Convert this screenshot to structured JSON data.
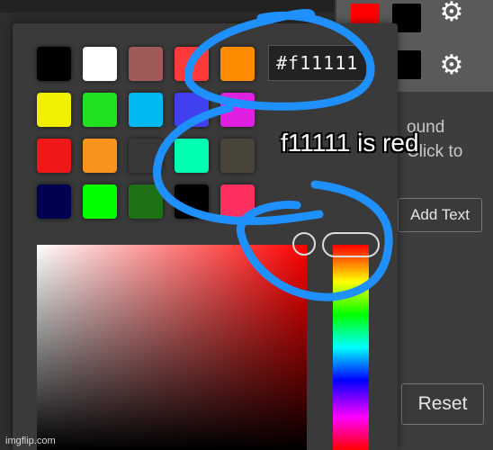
{
  "colors": {
    "swatches": [
      "#000000",
      "#ffffff",
      "#a05a5a",
      "#ff3a3a",
      "#ff8c00",
      "#f0f000",
      "#22e022",
      "#00b8f0",
      "#4040f0",
      "#e020e0",
      "#f01818",
      "#f7941d",
      "#383838",
      "#00ffb0",
      "#4a453a",
      "#000050",
      "#00ff00",
      "#207018",
      "#000000",
      "#ff3060"
    ],
    "side_swatch_top_red": "#ff0000",
    "side_swatch_top_black": "#000000",
    "side_swatch_mid_black": "#000000",
    "scribble": "#1e90ff"
  },
  "picker": {
    "hex_value": "#f11111"
  },
  "side": {
    "text_line1": "ound",
    "text_line2": "Click to",
    "add_text_label": "Add Text",
    "reset_label": "Reset"
  },
  "annotation": {
    "text": "f11111 is red"
  },
  "watermark": {
    "text": "imgflip.com"
  }
}
